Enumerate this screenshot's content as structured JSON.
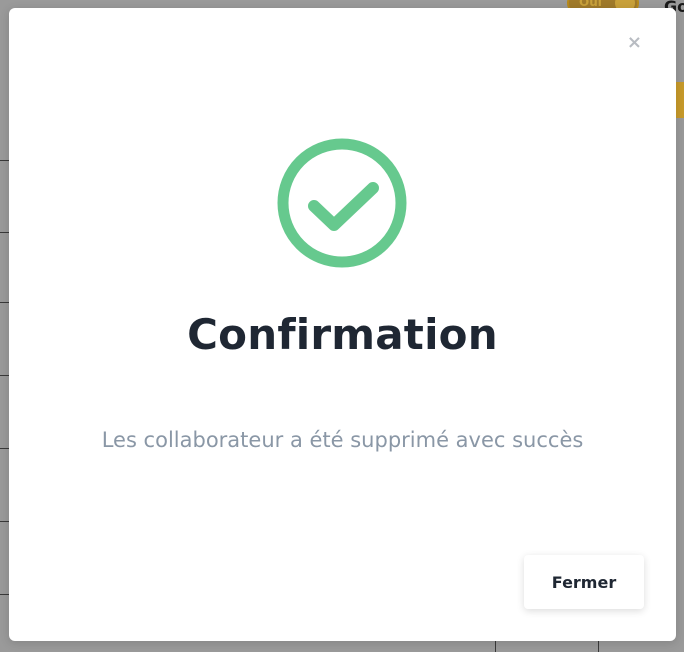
{
  "background": {
    "toggle_label": "Oui",
    "heading_fragment": "Go"
  },
  "modal": {
    "close_symbol": "×",
    "icon": "check-circle-icon",
    "title": "Confirmation",
    "message": "Les collaborateur a été supprimé avec succès",
    "close_button_label": "Fermer"
  },
  "colors": {
    "success": "#66c98e",
    "title": "#1f2733",
    "message": "#8a97a6"
  }
}
